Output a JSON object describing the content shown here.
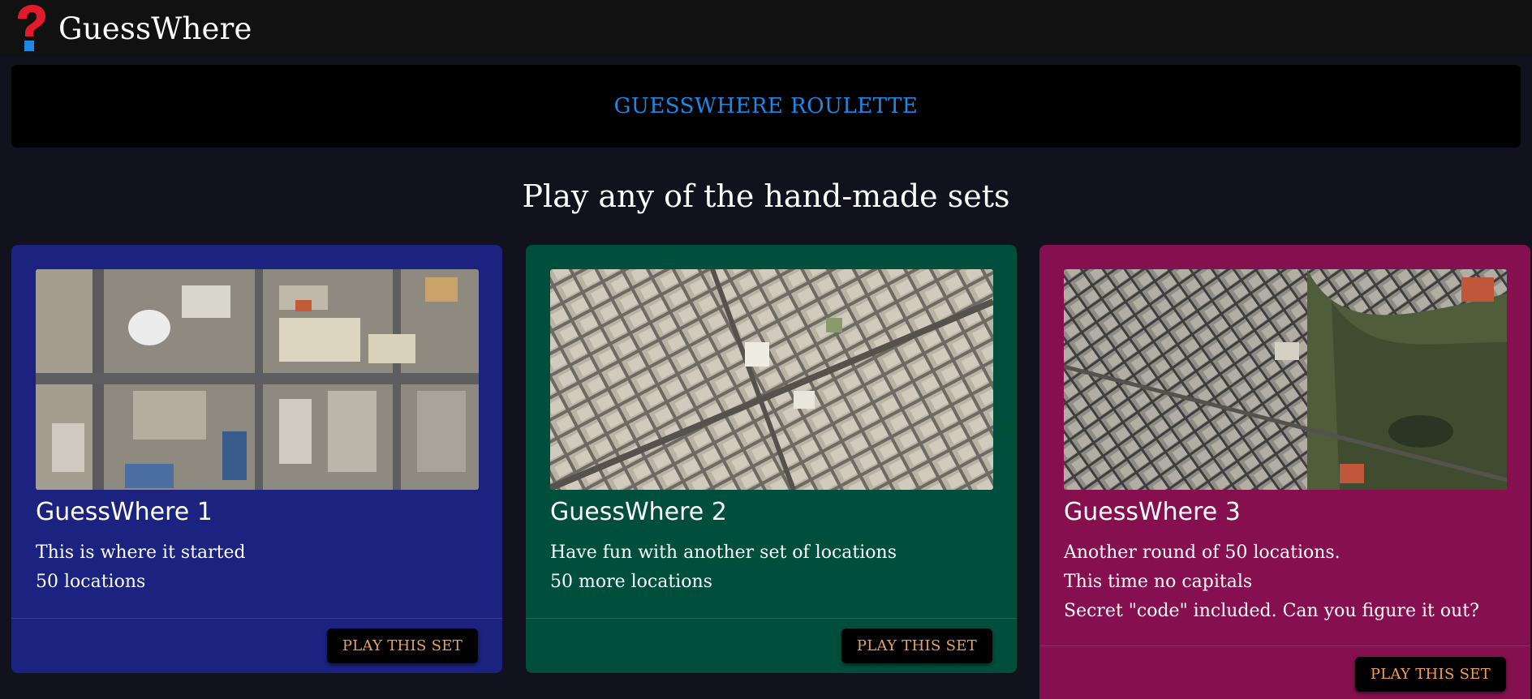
{
  "header": {
    "app_title": "GuessWhere",
    "logo_icon": "red-question-mark-icon"
  },
  "roulette": {
    "label": "GUESSWHERE ROULETTE"
  },
  "section": {
    "heading": "Play any of the hand-made sets"
  },
  "cards": [
    {
      "title": "GuessWhere 1",
      "description": [
        "This is where it started",
        "50 locations"
      ],
      "button_label": "PLAY THIS SET",
      "background": "#1b2280"
    },
    {
      "title": "GuessWhere 2",
      "description": [
        "Have fun with another set of locations",
        "50 more locations"
      ],
      "button_label": "PLAY THIS SET",
      "background": "#004e3c"
    },
    {
      "title": "GuessWhere 3",
      "description": [
        "Another round of 50 locations.",
        "This time no capitals",
        "Secret \"code\" included. Can you figure it out?"
      ],
      "button_label": "PLAY THIS SET",
      "background": "#860f4f"
    }
  ],
  "colors": {
    "page_background": "#12121f",
    "topbar_background": "#111112",
    "roulette_text": "#1e88e5",
    "button_text": "#f0a050"
  }
}
